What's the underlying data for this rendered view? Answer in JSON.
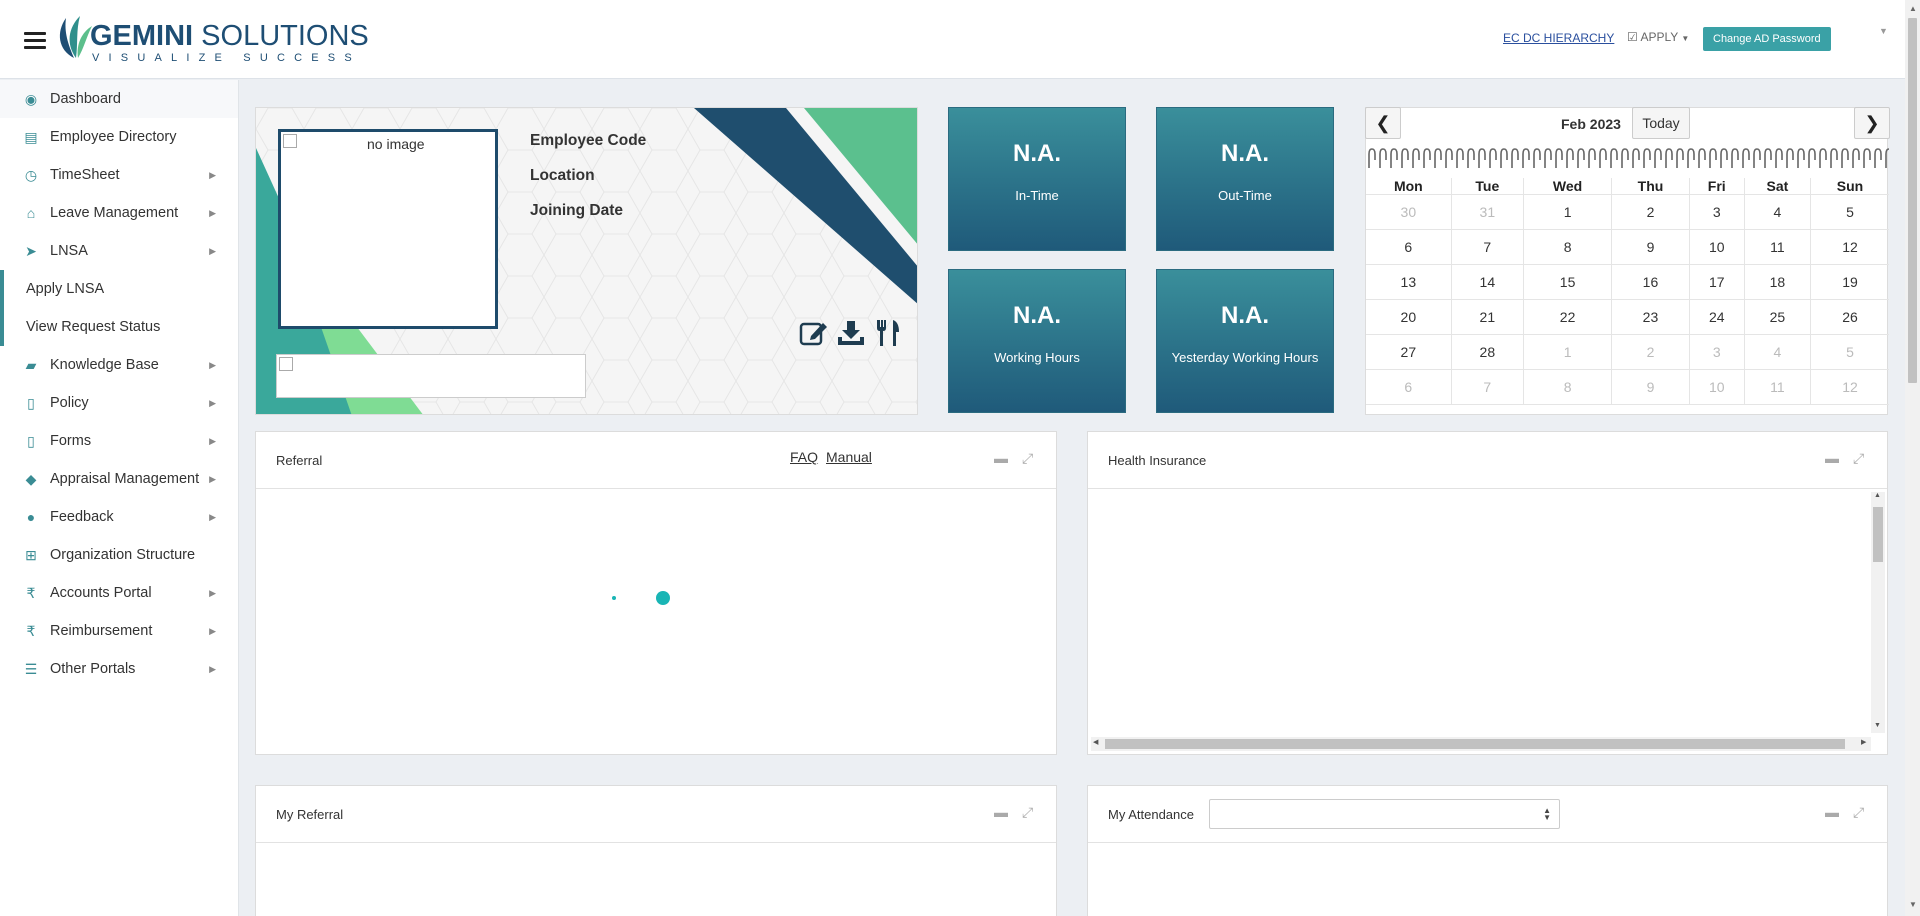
{
  "header": {
    "brand_bold": "GEMINI",
    "brand_light": " SOLUTIONS",
    "tagline": "VISUALIZE SUCCESS",
    "hierarchy_link": "EC DC HIERARCHY",
    "apply_label": "APPLY",
    "change_password_label": "Change AD Password",
    "accent_color": "#3aa1a6"
  },
  "sidebar": {
    "items": [
      {
        "label": "Dashboard",
        "icon": "dashboard-icon",
        "arrow": false
      },
      {
        "label": "Employee Directory",
        "icon": "directory-icon",
        "arrow": false
      },
      {
        "label": "TimeSheet",
        "icon": "clock-icon",
        "arrow": true
      },
      {
        "label": "Leave Management",
        "icon": "home-icon",
        "arrow": true
      },
      {
        "label": "LNSA",
        "icon": "paper-plane-icon",
        "arrow": true
      }
    ],
    "subitems": [
      {
        "label": "Apply LNSA"
      },
      {
        "label": "View Request Status"
      }
    ],
    "items2": [
      {
        "label": "Knowledge Base",
        "icon": "folder-open-icon",
        "arrow": true
      },
      {
        "label": "Policy",
        "icon": "file-icon",
        "arrow": true
      },
      {
        "label": "Forms",
        "icon": "file-icon",
        "arrow": true
      },
      {
        "label": "Appraisal Management",
        "icon": "graduation-cap-icon",
        "arrow": true
      },
      {
        "label": "Feedback",
        "icon": "comments-icon",
        "arrow": true
      },
      {
        "label": "Organization Structure",
        "icon": "sitemap-icon",
        "arrow": false
      },
      {
        "label": "Accounts Portal",
        "icon": "rupee-icon",
        "arrow": true
      },
      {
        "label": "Reimbursement",
        "icon": "rupee-icon",
        "arrow": true
      },
      {
        "label": "Other Portals",
        "icon": "list-icon",
        "arrow": true
      }
    ]
  },
  "profile": {
    "photo_alt": "no image",
    "labels": [
      "Employee Code",
      "Location",
      "Joining Date"
    ]
  },
  "tiles": [
    {
      "value": "N.A.",
      "label": "In-Time"
    },
    {
      "value": "N.A.",
      "label": "Out-Time"
    },
    {
      "value": "N.A.",
      "label": "Working Hours"
    },
    {
      "value": "N.A.",
      "label": "Yesterday Working Hours"
    }
  ],
  "calendar": {
    "title": "Feb 2023",
    "today_label": "Today",
    "prev_label": "❮",
    "next_label": "❯",
    "weekdays": [
      "Mon",
      "Tue",
      "Wed",
      "Thu",
      "Fri",
      "Sat",
      "Sun"
    ],
    "weeks": [
      [
        [
          "30",
          true
        ],
        [
          "31",
          true
        ],
        [
          "1",
          false
        ],
        [
          "2",
          false
        ],
        [
          "3",
          false
        ],
        [
          "4",
          false
        ],
        [
          "5",
          false
        ]
      ],
      [
        [
          "6",
          false
        ],
        [
          "7",
          false
        ],
        [
          "8",
          false
        ],
        [
          "9",
          false
        ],
        [
          "10",
          false
        ],
        [
          "11",
          false
        ],
        [
          "12",
          false
        ]
      ],
      [
        [
          "13",
          false
        ],
        [
          "14",
          false
        ],
        [
          "15",
          false
        ],
        [
          "16",
          false
        ],
        [
          "17",
          false
        ],
        [
          "18",
          false
        ],
        [
          "19",
          false
        ]
      ],
      [
        [
          "20",
          false
        ],
        [
          "21",
          false
        ],
        [
          "22",
          false
        ],
        [
          "23",
          false
        ],
        [
          "24",
          false
        ],
        [
          "25",
          false
        ],
        [
          "26",
          false
        ]
      ],
      [
        [
          "27",
          false
        ],
        [
          "28",
          false
        ],
        [
          "1",
          true
        ],
        [
          "2",
          true
        ],
        [
          "3",
          true
        ],
        [
          "4",
          true
        ],
        [
          "5",
          true
        ]
      ],
      [
        [
          "6",
          true
        ],
        [
          "7",
          true
        ],
        [
          "8",
          true
        ],
        [
          "9",
          true
        ],
        [
          "10",
          true
        ],
        [
          "11",
          true
        ],
        [
          "12",
          true
        ]
      ]
    ]
  },
  "panels": {
    "referral": {
      "title": "Referral",
      "faq": "FAQ",
      "manual": "Manual"
    },
    "health": {
      "title": "Health Insurance"
    },
    "my_referral": {
      "title": "My Referral"
    },
    "attendance": {
      "title": "My Attendance",
      "select_value": ""
    }
  }
}
